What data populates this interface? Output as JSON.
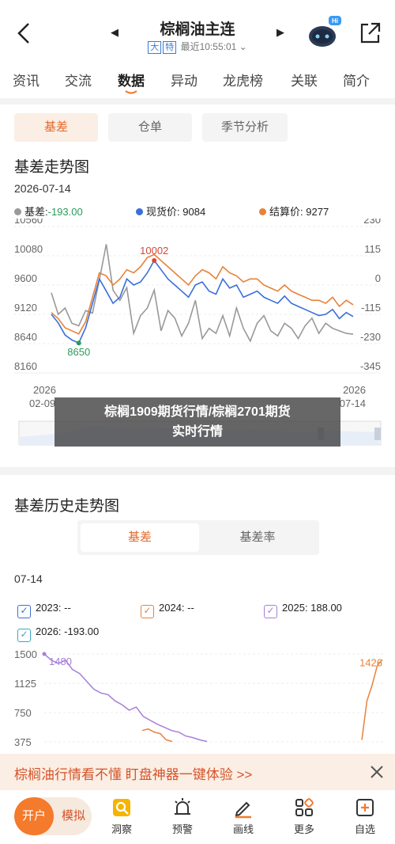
{
  "header": {
    "title": "棕榈油主连",
    "tag1": "大",
    "tag2": "特",
    "status": "最近10:55:01",
    "bot_badge": "Hi"
  },
  "tabs": [
    "资讯",
    "交流",
    "数据",
    "异动",
    "龙虎榜",
    "关联",
    "简介"
  ],
  "active_tab": "数据",
  "subtabs": [
    "基差",
    "仓单",
    "季节分析"
  ],
  "section1": {
    "title": "基差走势图",
    "date": "2026-07-14",
    "legend": [
      {
        "label": "基差:",
        "value": "-193.00",
        "color": "#999999",
        "value_color": "#2a9a5a"
      },
      {
        "label": "现货价:",
        "value": "9084",
        "color": "#3a6fd8",
        "value_color": "#222222"
      },
      {
        "label": "结算价:",
        "value": "9277",
        "color": "#e7823a",
        "value_color": "#222222"
      }
    ]
  },
  "chart_data": [
    {
      "type": "line",
      "title": "基差走势图",
      "y_left_ticks": [
        "10560",
        "10080",
        "9600",
        "9120",
        "8640",
        "8160"
      ],
      "y_right_ticks": [
        "230",
        "115",
        "0",
        "-115",
        "-230",
        "-345"
      ],
      "y_left_range": [
        8160,
        10560
      ],
      "y_right_range": [
        -345,
        230
      ],
      "x_start_label": [
        "2026",
        "02-09"
      ],
      "x_end_label": [
        "2026",
        "07-14"
      ],
      "annotations": [
        {
          "text": "10002",
          "series": "现货价",
          "color": "#d9453a"
        },
        {
          "text": "8650",
          "series": "现货价",
          "color": "#2a9a5a"
        }
      ],
      "series": [
        {
          "name": "现货价",
          "color": "#3a6fd8",
          "axis": "left",
          "values": [
            9120,
            8980,
            8780,
            8700,
            8650,
            8900,
            9300,
            9700,
            9500,
            9300,
            9400,
            9700,
            9600,
            9650,
            9800,
            10002,
            9850,
            9700,
            9600,
            9500,
            9400,
            9600,
            9650,
            9500,
            9450,
            9700,
            9550,
            9600,
            9400,
            9450,
            9500,
            9400,
            9350,
            9300,
            9420,
            9300,
            9250,
            9200,
            9150,
            9100,
            9120,
            9200,
            9050,
            9150,
            9084
          ]
        },
        {
          "name": "结算价",
          "color": "#e7823a",
          "axis": "left",
          "values": [
            9150,
            9050,
            8900,
            8850,
            8800,
            9000,
            9400,
            9800,
            9750,
            9600,
            9700,
            9850,
            9800,
            9900,
            10050,
            10100,
            10000,
            9900,
            9800,
            9700,
            9600,
            9750,
            9850,
            9800,
            9700,
            9900,
            9800,
            9750,
            9650,
            9700,
            9700,
            9600,
            9550,
            9500,
            9600,
            9500,
            9450,
            9400,
            9350,
            9350,
            9300,
            9400,
            9250,
            9350,
            9277
          ]
        },
        {
          "name": "基差",
          "color": "#999999",
          "axis": "right",
          "values": [
            -30,
            -115,
            -90,
            -150,
            -160,
            -100,
            -110,
            20,
            160,
            -20,
            -60,
            -10,
            -190,
            -120,
            -90,
            -20,
            -180,
            -100,
            -130,
            -200,
            -150,
            -60,
            -210,
            -170,
            -190,
            -120,
            -200,
            -90,
            -170,
            -220,
            -150,
            -120,
            -180,
            -200,
            -150,
            -170,
            -210,
            -160,
            -130,
            -190,
            -150,
            -170,
            -180,
            -190,
            -193
          ]
        }
      ]
    },
    {
      "type": "line",
      "title": "基差历史走势图",
      "y_ticks": [
        "1500",
        "1125",
        "750",
        "375"
      ],
      "y_range": [
        375,
        1500
      ],
      "annotations": [
        {
          "text": "1480",
          "color": "#a67fd8"
        },
        {
          "text": "1426",
          "color": "#e7823a"
        }
      ],
      "series": [
        {
          "name": "2025",
          "color": "#a67fd8",
          "values": [
            1500,
            1420,
            1380,
            1420,
            1300,
            1250,
            1150,
            1050,
            1000,
            980,
            900,
            850,
            780,
            820,
            700,
            650,
            600,
            560,
            520,
            500,
            450,
            430,
            400,
            380
          ]
        },
        {
          "name": "2024",
          "color": "#e7823a",
          "values": [
            520,
            540,
            500,
            480,
            400,
            380
          ]
        },
        {
          "name": "2024b",
          "color": "#e7823a",
          "values": [
            400,
            900,
            1100,
            1350,
            1426
          ]
        }
      ]
    }
  ],
  "section2": {
    "title": "基差历史走势图",
    "toggle": [
      "基差",
      "基差率"
    ],
    "date": "07-14",
    "legend": [
      {
        "label": "2023: --",
        "color": "#3a6fd8"
      },
      {
        "label": "2024: --",
        "color": "#e7823a"
      },
      {
        "label": "2025: 188.00",
        "color": "#a67fd8"
      },
      {
        "label": "2026: -193.00",
        "color": "#3aa6c8"
      }
    ]
  },
  "overlay": {
    "line1": "棕榈1909期货行情/棕榈2701期货",
    "line2": "实时行情"
  },
  "promo": {
    "text": "棕榈油行情看不懂  盯盘神器一键体验 >>"
  },
  "bottom": {
    "kai": "开户",
    "moni": "模拟",
    "nav": [
      "洞察",
      "预警",
      "画线",
      "更多",
      "自选"
    ]
  }
}
